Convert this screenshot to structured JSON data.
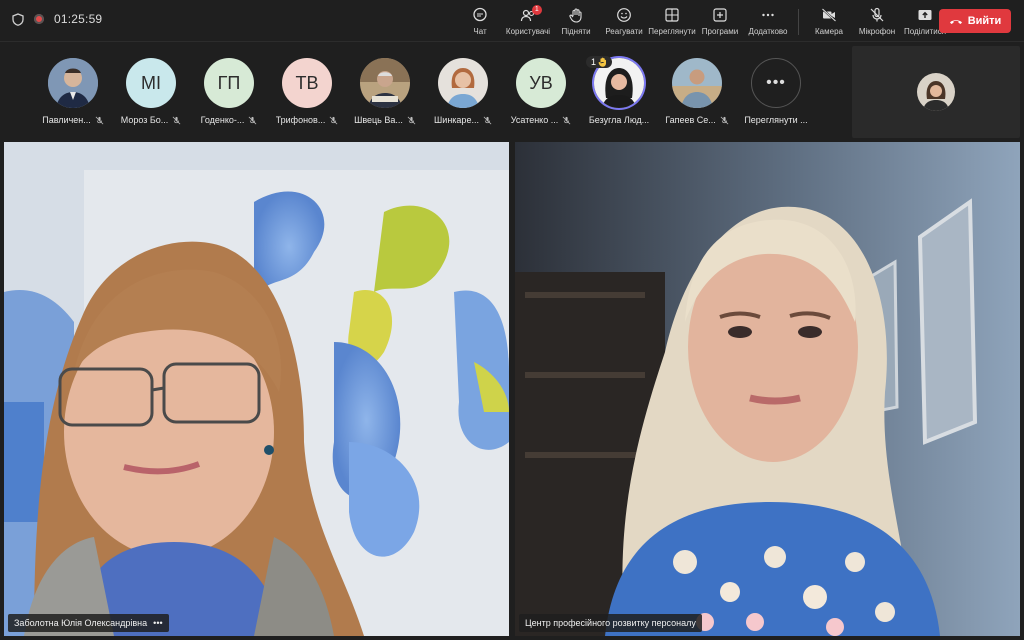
{
  "topbar": {
    "timer": "01:25:59",
    "tools": [
      {
        "label": "Чат",
        "icon": "chat-icon"
      },
      {
        "label": "Користувачі",
        "icon": "users-icon",
        "badge": "1"
      },
      {
        "label": "Підняти",
        "icon": "raise-hand-icon"
      },
      {
        "label": "Реагувати",
        "icon": "react-icon"
      },
      {
        "label": "Переглянути",
        "icon": "view-icon"
      },
      {
        "label": "Програми",
        "icon": "apps-icon"
      },
      {
        "label": "Додатково",
        "icon": "more-icon"
      }
    ],
    "device_tools": [
      {
        "label": "Камера",
        "icon": "camera-off-icon"
      },
      {
        "label": "Мікрофон",
        "icon": "mic-off-icon"
      },
      {
        "label": "Поділитися",
        "icon": "share-icon"
      }
    ],
    "leave_label": "Вийти"
  },
  "participants": [
    {
      "name": "Павличен...",
      "initials": "",
      "photo": true
    },
    {
      "name": "Мороз Бо...",
      "initials": "МІ",
      "color": "#c9e8ec"
    },
    {
      "name": "Годенко-...",
      "initials": "ГП",
      "color": "#d7ead6"
    },
    {
      "name": "Трифонов...",
      "initials": "ТВ",
      "color": "#f3d4cf"
    },
    {
      "name": "Швець Ва...",
      "initials": "",
      "photo": true
    },
    {
      "name": "Шинкаре...",
      "initials": "",
      "photo": true
    },
    {
      "name": "Усатенко ...",
      "initials": "УВ",
      "color": "#d7ead6"
    },
    {
      "name": "Безугла Люд...",
      "initials": "",
      "photo": true,
      "hand": "1"
    },
    {
      "name": "Гапеев Се...",
      "initials": "",
      "photo": true
    },
    {
      "name": "Переглянути ...",
      "initials": "•••",
      "more": true
    }
  ],
  "tiles": [
    {
      "name": "Заболотна Юлія Олександрівна",
      "more": "•••"
    },
    {
      "name": "Центр професійного розвитку персоналу"
    }
  ]
}
